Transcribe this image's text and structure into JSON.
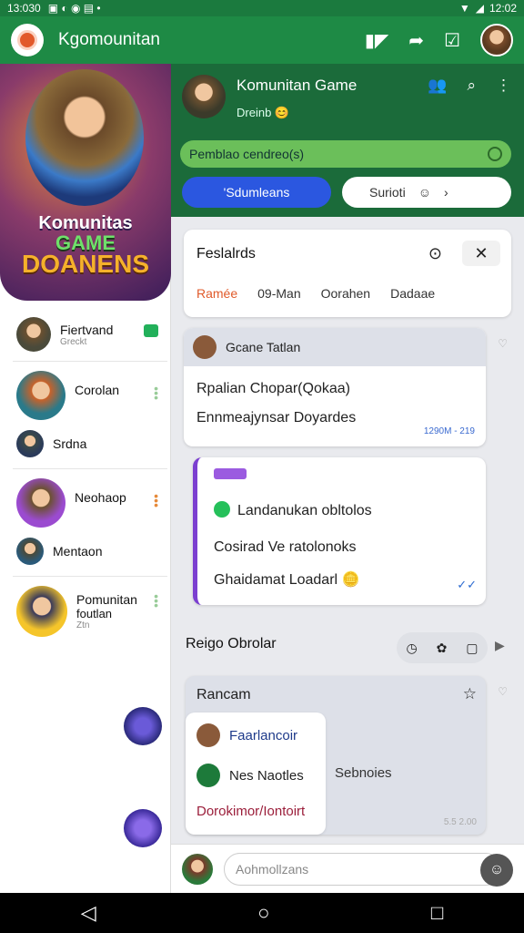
{
  "status": {
    "time": "13:030",
    "right_time": "12:02"
  },
  "appbar": {
    "title": "Kgomounitan"
  },
  "sidebar": {
    "banner": {
      "line1": "Komunitas",
      "line2": "GAME",
      "line3": "DOANENS"
    },
    "items": [
      {
        "name": "Fiertvand",
        "sub": "Greckt"
      },
      {
        "name": "Corolan",
        "sub": ""
      },
      {
        "name": "Srdna",
        "sub": ""
      },
      {
        "name": "Neohaop",
        "sub": ""
      },
      {
        "name": "Mentaon",
        "sub": ""
      },
      {
        "name": "Pomunitan",
        "sub2": "foutlan",
        "sub": "Ztn"
      }
    ]
  },
  "chat_header": {
    "title": "Komunitan Game",
    "subtitle": "Dreinb",
    "banner": "Pemblao cendreo(s)",
    "btn_primary": "'Sdumleans",
    "btn_secondary": "Surioti"
  },
  "filters": {
    "title": "Feslalrds",
    "tabs": [
      "Ramée",
      "09-Man",
      "Oorahen",
      "Dadaae"
    ],
    "close": "✕"
  },
  "group": {
    "name": "Gcane Tatlan",
    "line1": "Rpalian Chopar(Qokaa)",
    "line2": "Ennmeajynsar Doyardes",
    "time": "1290M - 219"
  },
  "message": {
    "line1": "Landanukan obltolos",
    "line2": "Cosirad Ve ratolonoks",
    "line3": "Ghaidamat Loadarl",
    "check": "✓✓"
  },
  "section": {
    "title": "Reigo Obrolar"
  },
  "recent": {
    "title": "Rancam",
    "items": [
      "Faarlancoir",
      "Nes Naotles",
      "Dorokimor/Iontoirt"
    ],
    "side": "Sebnoies",
    "time": "5.5 2.00"
  },
  "input": {
    "placeholder": "Aohmollzans"
  },
  "colors": {
    "appbar": "#1e8a45",
    "header": "#1b6b3a",
    "accent": "#2b57e0",
    "active_tab": "#e05a2a"
  }
}
